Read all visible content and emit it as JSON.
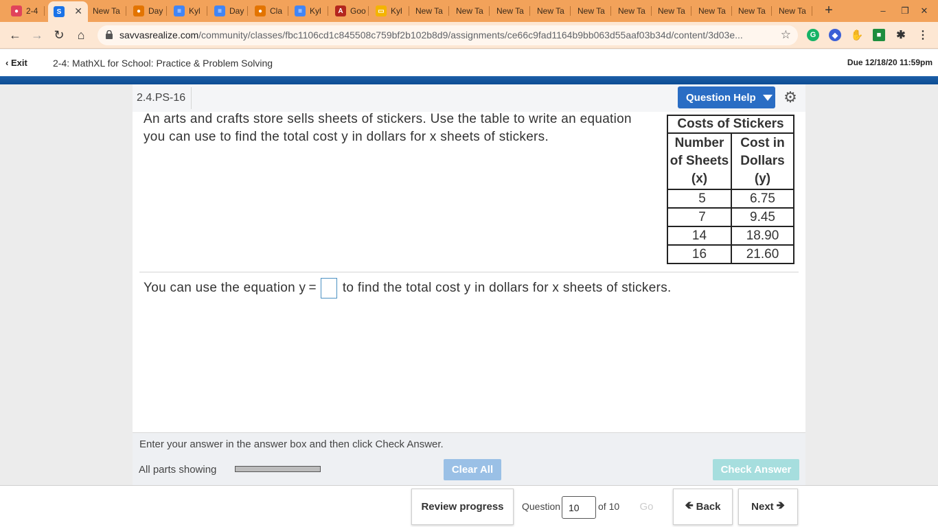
{
  "browser": {
    "tabs": [
      {
        "label": "2-4",
        "icon": "person-app-icon",
        "color": "#e0435b"
      },
      {
        "label": "",
        "icon": "savvas-icon",
        "color": "#1a73e8",
        "active": true
      },
      {
        "label": "New Ta",
        "icon": "",
        "color": ""
      },
      {
        "label": "Day",
        "icon": "classroom-icon",
        "color": "#e37400"
      },
      {
        "label": "Kyl",
        "icon": "docs-icon",
        "color": "#4285f4"
      },
      {
        "label": "Day",
        "icon": "docs-icon",
        "color": "#4285f4"
      },
      {
        "label": "Cla",
        "icon": "classroom-icon",
        "color": "#e37400"
      },
      {
        "label": "Kyl",
        "icon": "docs-icon",
        "color": "#4285f4"
      },
      {
        "label": "Goo",
        "icon": "a-icon",
        "color": "#b3261e"
      },
      {
        "label": "Kyl",
        "icon": "slides-icon",
        "color": "#f4b400"
      },
      {
        "label": "New Ta",
        "icon": "",
        "color": ""
      },
      {
        "label": "New Ta",
        "icon": "",
        "color": ""
      },
      {
        "label": "New Ta",
        "icon": "",
        "color": ""
      },
      {
        "label": "New Ta",
        "icon": "",
        "color": ""
      },
      {
        "label": "New Ta",
        "icon": "",
        "color": ""
      },
      {
        "label": "New Ta",
        "icon": "",
        "color": ""
      },
      {
        "label": "New Ta",
        "icon": "",
        "color": ""
      },
      {
        "label": "New Ta",
        "icon": "",
        "color": ""
      },
      {
        "label": "New Ta",
        "icon": "",
        "color": ""
      },
      {
        "label": "New Ta",
        "icon": "",
        "color": ""
      }
    ],
    "url_host": "savvasrealize.com",
    "url_path": "/community/classes/fbc1106cd1c845508c759bf2b102b8d9/assignments/ce66c9fad1164b9bb063d55aaf03b34d/content/3d03e..."
  },
  "header": {
    "exit_label": "Exit",
    "assignment_title": "2-4: MathXL for School: Practice & Problem Solving",
    "due": "Due 12/18/20 11:59pm"
  },
  "question": {
    "id": "2.4.PS-16",
    "help_label": "Question Help",
    "text": "An arts and crafts store sells sheets of stickers. Use the table to write an equation you can use to find the total cost y in dollars for x sheets of stickers.",
    "table": {
      "title": "Costs of Stickers",
      "col1": "Number of Sheets (x)",
      "col2": "Cost in Dollars (y)",
      "rows": [
        {
          "x": "5",
          "y": "6.75"
        },
        {
          "x": "7",
          "y": "9.45"
        },
        {
          "x": "14",
          "y": "18.90"
        },
        {
          "x": "16",
          "y": "21.60"
        }
      ]
    },
    "answer_prefix": "You can use the equation y =",
    "answer_suffix": "to find the total cost y in dollars for x sheets of stickers.",
    "hint": "Enter your answer in the answer box and then click Check Answer.",
    "parts_label": "All parts showing",
    "progress": 1.0,
    "clear_label": "Clear All",
    "check_label": "Check Answer"
  },
  "footer": {
    "review_label": "Review progress",
    "question_label": "Question",
    "question_value": "10",
    "of_label": "of 10",
    "go_label": "Go",
    "back_label": "Back",
    "next_label": "Next"
  }
}
